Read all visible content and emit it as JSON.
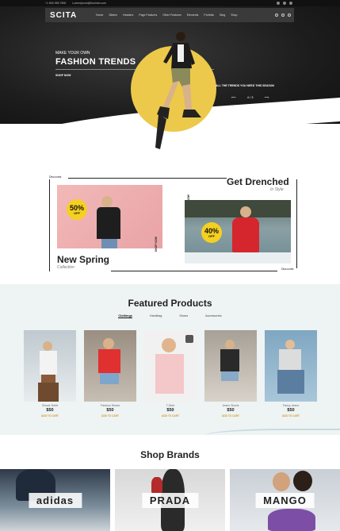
{
  "topbar": {
    "phone": "+1 800 555 7890",
    "email": "Loremipsum@blochub.com"
  },
  "header": {
    "logo": "SCITA",
    "menu": [
      "Home",
      "Sliders",
      "Headers",
      "Page Features",
      "Other Features",
      "Elements",
      "Portfolio",
      "Blog",
      "Shop"
    ],
    "icons": [
      "search-icon",
      "user-icon",
      "cart-icon"
    ]
  },
  "hero": {
    "subtitle": "MAKE YOUR OWN",
    "title": "FASHION TRENDS",
    "cta": "SHOP NOW",
    "tagline": "ALL THE TRENDS YOU NEED THIS SEASON",
    "slide_indicator": "4 / 3",
    "accent_color": "#ecc94b"
  },
  "promo": {
    "discounts_label_top": "Discounts",
    "discounts_label_bottom": "Discounts",
    "left_badge_value": "50%",
    "left_badge_sub": "OFF",
    "left_title": "New Spring",
    "left_subtitle": "Collection",
    "left_cta": "SHOP NOW",
    "right_title": "Get Drenched",
    "right_subtitle": "In Style",
    "right_badge_value": "40%",
    "right_badge_sub": "OFF",
    "right_cta": "SHOP NOW"
  },
  "featured": {
    "title": "Featured Products",
    "tabs": [
      "Clothings",
      "Handbag",
      "Shoes",
      "Accessories"
    ],
    "active_tab": "Clothings",
    "products": [
      {
        "name": "Shorts Tshirt",
        "price": "$50",
        "cta": "ADD TO CART"
      },
      {
        "name": "Fashion Shorts",
        "price": "$50",
        "cta": "ADD TO CART"
      },
      {
        "name": "T-Shirt",
        "price": "$50",
        "cta": "ADD TO CART"
      },
      {
        "name": "Jeans Shorts",
        "price": "$50",
        "cta": "ADD TO CART"
      },
      {
        "name": "Fancy Jeans",
        "price": "$50",
        "cta": "ADD TO CART"
      }
    ]
  },
  "brands": {
    "title": "Shop Brands",
    "items": [
      "adidas",
      "PRADA",
      "MANGO"
    ]
  }
}
